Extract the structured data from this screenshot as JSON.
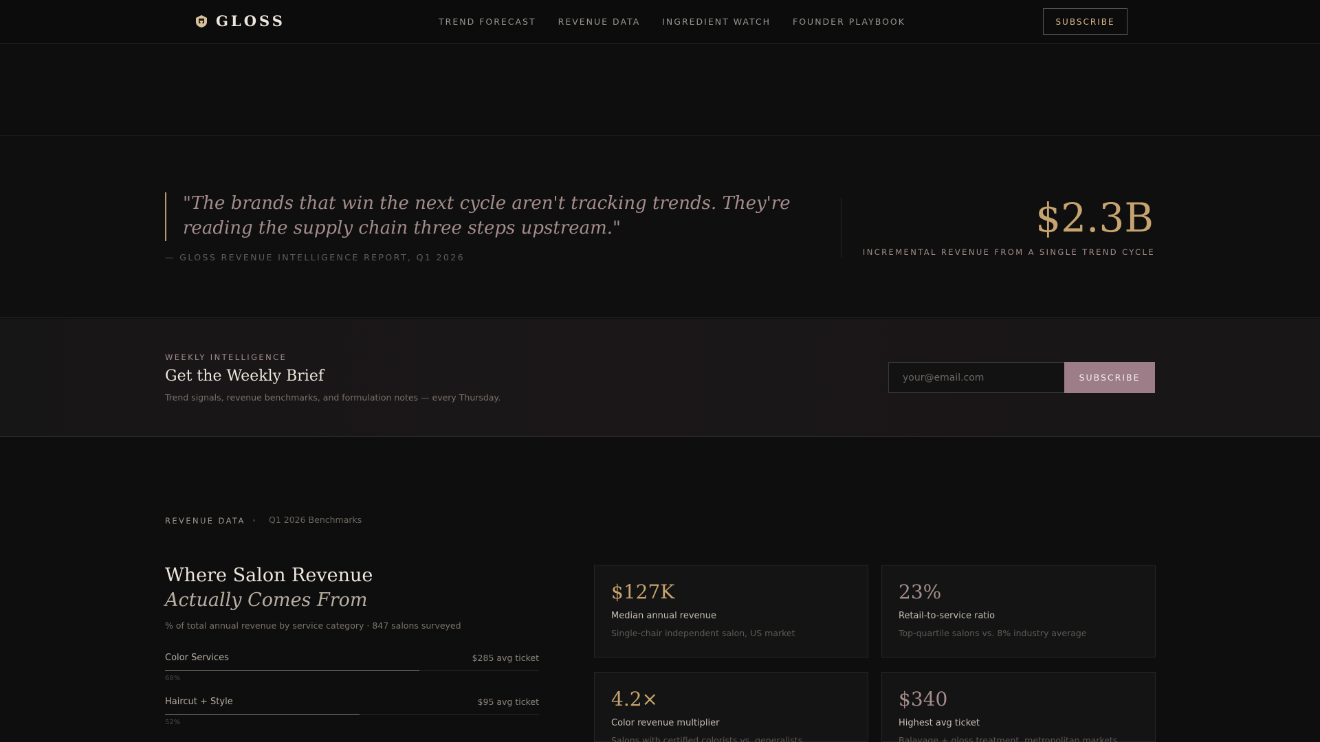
{
  "nav": {
    "logo_text": "GLOSS",
    "links": [
      "TREND FORECAST",
      "REVENUE DATA",
      "INGREDIENT WATCH",
      "FOUNDER PLAYBOOK"
    ],
    "subscribe_label": "SUBSCRIBE"
  },
  "quote": {
    "text": "\"The brands that win the next cycle aren't tracking trends. They're reading the supply chain three steps upstream.\"",
    "source": "— GLOSS REVENUE INTELLIGENCE REPORT, Q1 2026",
    "stat_value": "$2.3B",
    "stat_label": "INCREMENTAL REVENUE FROM A SINGLE TREND CYCLE"
  },
  "newsletter": {
    "eyebrow": "WEEKLY INTELLIGENCE",
    "title": "Get the Weekly Brief",
    "description": "Trend signals, revenue benchmarks, and formulation notes — every Thursday.",
    "email_placeholder": "your@email.com",
    "button_label": "SUBSCRIBE"
  },
  "revenue": {
    "eyebrow": "REVENUE DATA",
    "subtitle": "Q1 2026 Benchmarks",
    "heading_line1": "Where Salon Revenue",
    "heading_line2": "Actually Comes From",
    "description": "% of total annual revenue by service category · 847 salons surveyed",
    "bars": [
      {
        "name": "Color Services",
        "ticket": "$285 avg ticket",
        "pct_label": "68%",
        "fill": 0.68
      },
      {
        "name": "Haircut + Style",
        "ticket": "$95 avg ticket",
        "pct_label": "52%",
        "fill": 0.52
      }
    ],
    "cards": [
      {
        "value": "$127K",
        "title": "Median annual revenue",
        "desc": "Single-chair independent salon, US market",
        "color": "#c7a46f"
      },
      {
        "value": "23%",
        "title": "Retail-to-service ratio",
        "desc": "Top-quartile salons vs. 8% industry average",
        "color": "#a58c8c"
      },
      {
        "value": "4.2×",
        "title": "Color revenue multiplier",
        "desc": "Salons with certified colorists vs. generalists",
        "color": "#c7a46f"
      },
      {
        "value": "$340",
        "title": "Highest avg ticket",
        "desc": "Balayage + gloss treatment, metropolitan markets",
        "color": "#a58c8c"
      }
    ]
  },
  "colors": {
    "accent_gold": "#c7a46f",
    "accent_mauve": "#9c7d88",
    "background": "#0e0e0e"
  }
}
